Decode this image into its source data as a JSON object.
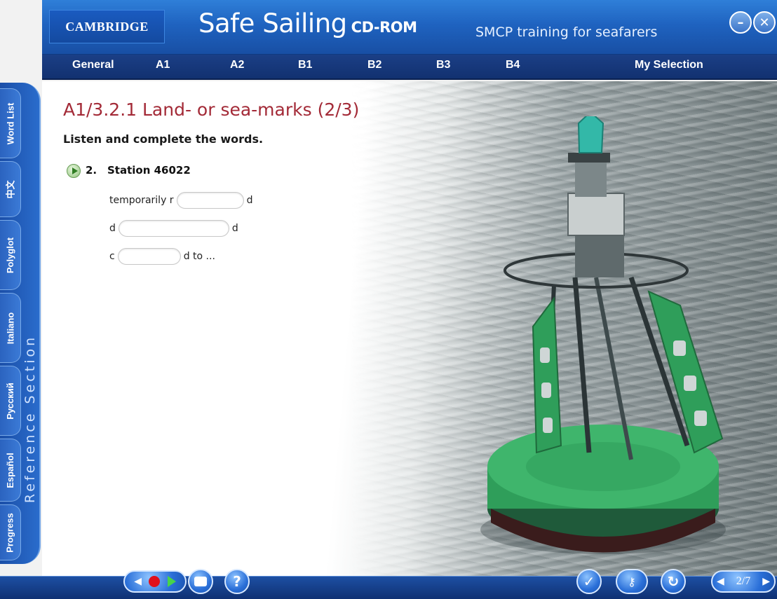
{
  "header": {
    "brand": "CAMBRIDGE",
    "title": "Safe Sailing",
    "title_suffix": "CD-ROM",
    "tagline": "SMCP training for seafarers",
    "minimize_icon": "minimize-icon",
    "close_icon": "close-icon"
  },
  "nav": {
    "items": [
      {
        "label": "General"
      },
      {
        "label": "A1"
      },
      {
        "label": "A2"
      },
      {
        "label": "B1"
      },
      {
        "label": "B2"
      },
      {
        "label": "B3"
      },
      {
        "label": "B4"
      },
      {
        "label": "My Selection"
      }
    ]
  },
  "sidebar": {
    "tabs": [
      {
        "label": "Word List"
      },
      {
        "label": "中文"
      },
      {
        "label": "Polyglot"
      },
      {
        "label": "Italiano"
      },
      {
        "label": "Русский"
      },
      {
        "label": "Español"
      },
      {
        "label": "Progress"
      }
    ],
    "section_label": "Reference Section"
  },
  "exercise": {
    "title": "A1/3.2.1 Land- or sea-marks (2/3)",
    "instruction": "Listen and complete the words.",
    "item_number": "2.",
    "item_title": "Station 46022",
    "rows": [
      {
        "prefix": "temporarily r",
        "suffix": "d",
        "value": ""
      },
      {
        "prefix": "d",
        "suffix": "d",
        "value": ""
      },
      {
        "prefix": "c",
        "suffix": "d to ...",
        "value": ""
      }
    ]
  },
  "footer": {
    "record_icon": "record-icon",
    "print_icon": "print-icon",
    "help_label": "?",
    "check_icon": "check-icon",
    "key_icon": "key-icon",
    "reset_icon": "reset-icon",
    "page_indicator": "2/7"
  },
  "colors": {
    "header_blue": "#1f63c0",
    "nav_blue": "#123170",
    "title_red": "#a32a37",
    "buoy_green": "#2f9e5a"
  }
}
